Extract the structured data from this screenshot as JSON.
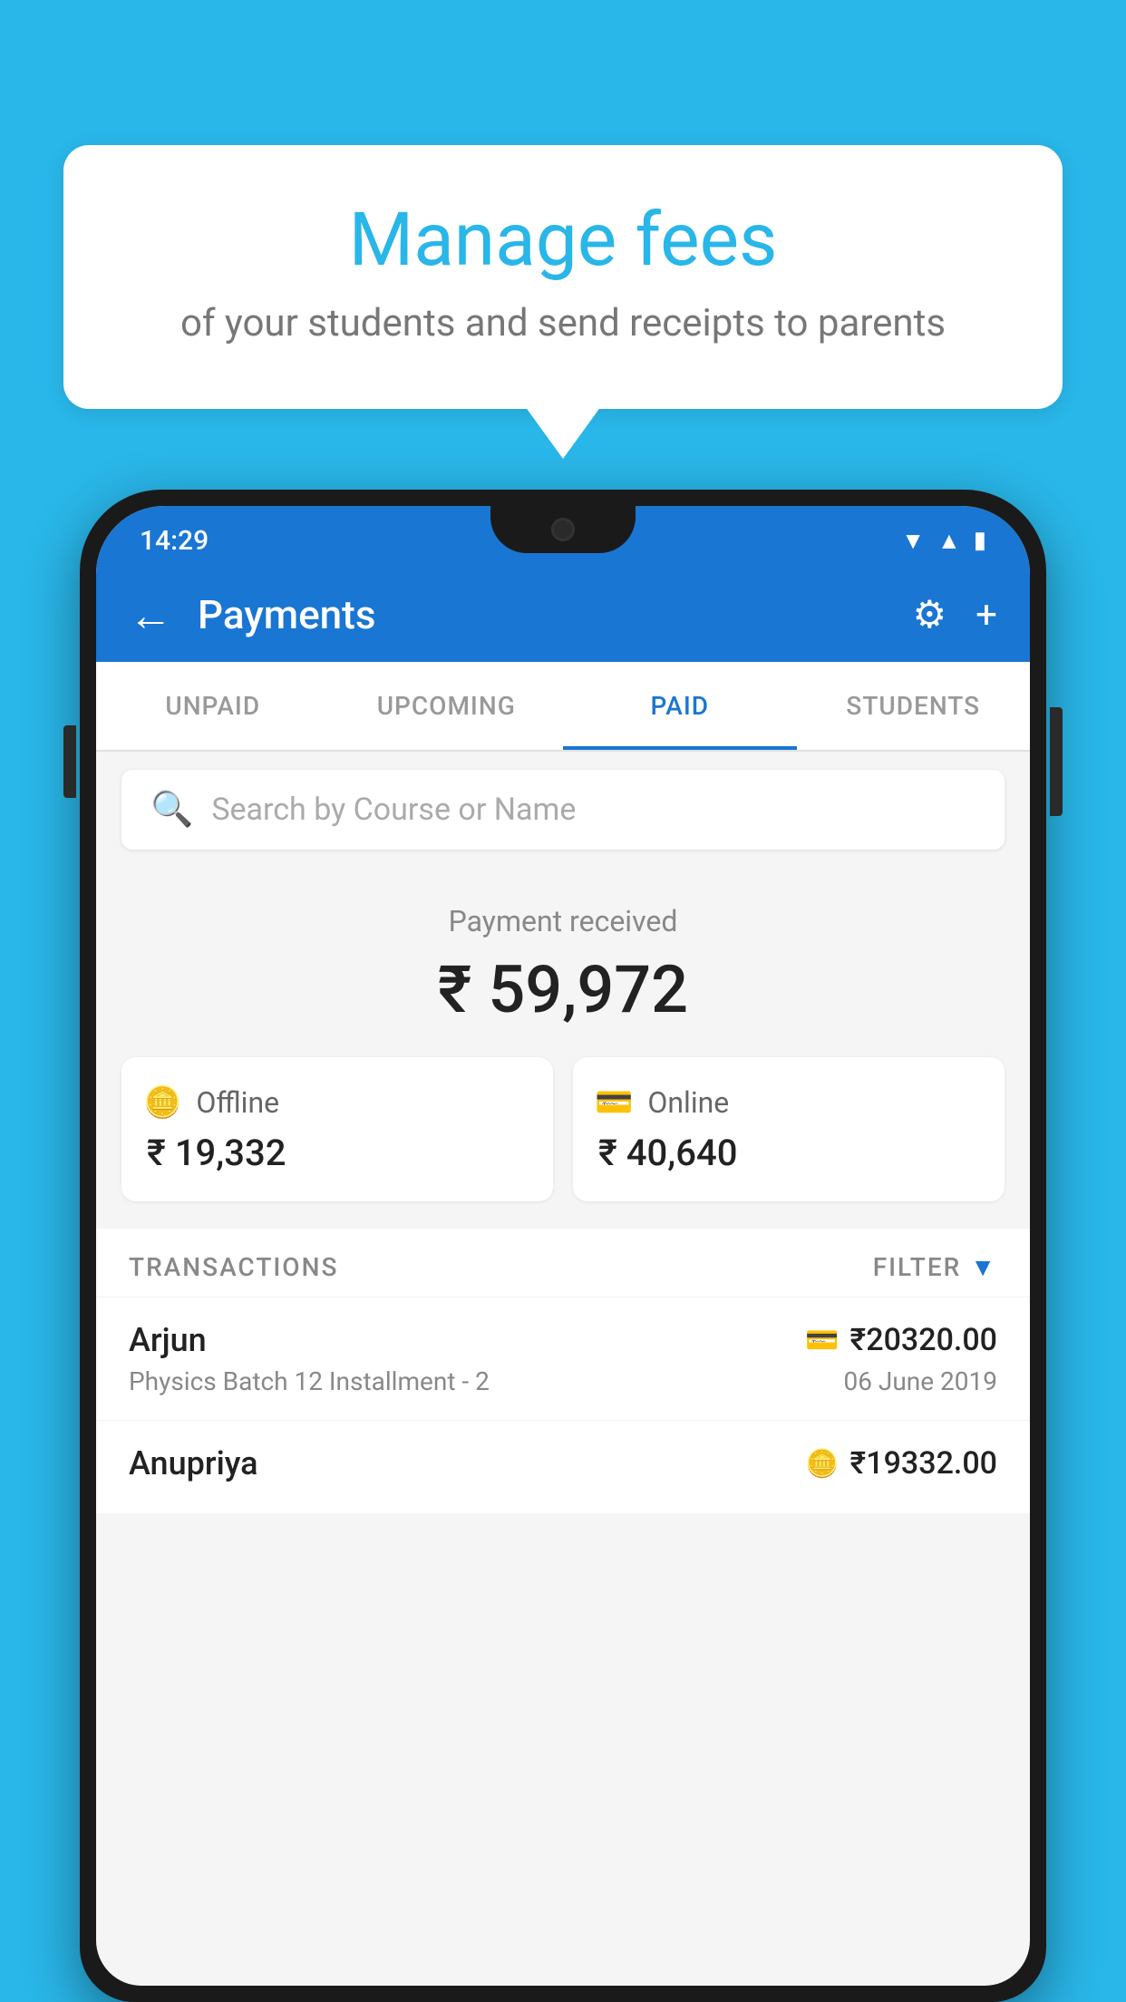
{
  "background_color": "#29b6e8",
  "bubble": {
    "title": "Manage fees",
    "subtitle": "of your students and send receipts to parents"
  },
  "status_bar": {
    "time": "14:29",
    "icons": [
      "wifi",
      "signal",
      "battery"
    ]
  },
  "app_bar": {
    "title": "Payments",
    "back_label": "←",
    "gear_label": "⚙",
    "plus_label": "+"
  },
  "tabs": [
    {
      "label": "UNPAID",
      "active": false
    },
    {
      "label": "UPCOMING",
      "active": false
    },
    {
      "label": "PAID",
      "active": true
    },
    {
      "label": "STUDENTS",
      "active": false
    }
  ],
  "search": {
    "placeholder": "Search by Course or Name"
  },
  "payment_summary": {
    "label": "Payment received",
    "amount": "₹ 59,972",
    "offline": {
      "type": "Offline",
      "amount": "₹ 19,332"
    },
    "online": {
      "type": "Online",
      "amount": "₹ 40,640"
    }
  },
  "transactions": {
    "label": "TRANSACTIONS",
    "filter_label": "FILTER",
    "rows": [
      {
        "name": "Arjun",
        "course": "Physics Batch 12 Installment - 2",
        "amount": "₹20320.00",
        "date": "06 June 2019",
        "payment_type": "online"
      },
      {
        "name": "Anupriya",
        "course": "",
        "amount": "₹19332.00",
        "date": "",
        "payment_type": "offline"
      }
    ]
  }
}
